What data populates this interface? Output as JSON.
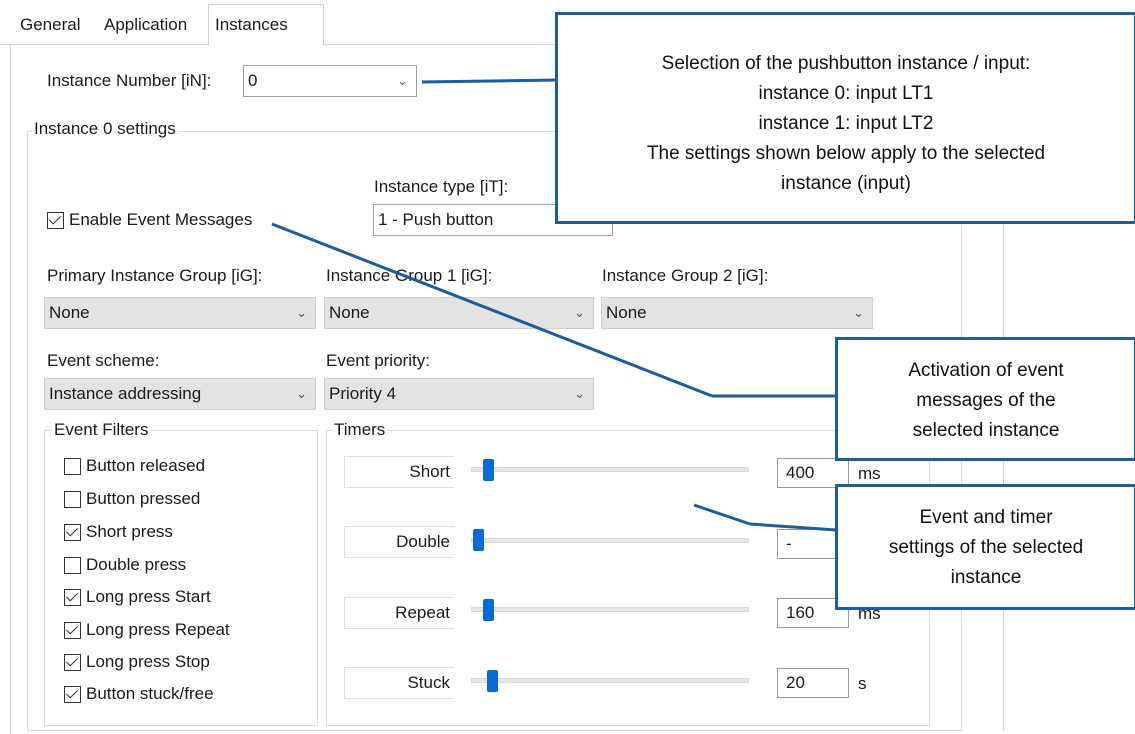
{
  "tabs": [
    {
      "label": "General"
    },
    {
      "label": "Application"
    },
    {
      "label": "Instances",
      "active": true
    }
  ],
  "instance_number": {
    "label": "Instance Number [iN]:",
    "value": "0"
  },
  "instance_settings": {
    "title": "Instance 0 settings"
  },
  "instance_type": {
    "label": "Instance type [iT]:",
    "value": "1 - Push button"
  },
  "enable_event_messages": {
    "label": "Enable Event Messages",
    "checked": true
  },
  "groups": {
    "primary": {
      "label": "Primary Instance Group [iG]:",
      "value": "None"
    },
    "group1": {
      "label": "Instance Group 1 [iG]:",
      "value": "None"
    },
    "group2": {
      "label": "Instance Group 2 [iG]:",
      "value": "None"
    }
  },
  "event_scheme": {
    "label": "Event scheme:",
    "value": "Instance addressing"
  },
  "event_priority": {
    "label": "Event priority:",
    "value": "Priority 4"
  },
  "event_filters": {
    "title": "Event Filters",
    "items": [
      {
        "label": "Button released",
        "checked": false
      },
      {
        "label": "Button pressed",
        "checked": false
      },
      {
        "label": "Short press",
        "checked": true
      },
      {
        "label": "Double press",
        "checked": false
      },
      {
        "label": "Long press Start",
        "checked": true
      },
      {
        "label": "Long press Repeat",
        "checked": true
      },
      {
        "label": "Long press Stop",
        "checked": true
      },
      {
        "label": "Button stuck/free",
        "checked": true
      }
    ]
  },
  "timers": {
    "title": "Timers",
    "items": [
      {
        "label": "Short",
        "value": "400",
        "unit": "ms"
      },
      {
        "label": "Double",
        "value": "-",
        "unit": ""
      },
      {
        "label": "Repeat",
        "value": "160",
        "unit": "ms"
      },
      {
        "label": "Stuck",
        "value": "20",
        "unit": "s"
      }
    ]
  },
  "callouts": {
    "instance_selection": {
      "lines": [
        "Selection of the pushbutton instance / input:",
        "instance 0: input LT1",
        "instance 1: input LT2",
        "The settings shown below apply to the selected",
        "instance (input)"
      ]
    },
    "activation": {
      "lines": [
        "Activation of event",
        "messages of the",
        "selected instance"
      ]
    },
    "event_timer": {
      "lines": [
        "Event and timer",
        "settings of the selected",
        "instance"
      ]
    }
  },
  "colors": {
    "accent": "#0a6ad8",
    "callout_border": "#1f5c99"
  },
  "icons": {
    "dropdown": "chevron-down-icon",
    "checkbox": "checkbox-icon"
  }
}
